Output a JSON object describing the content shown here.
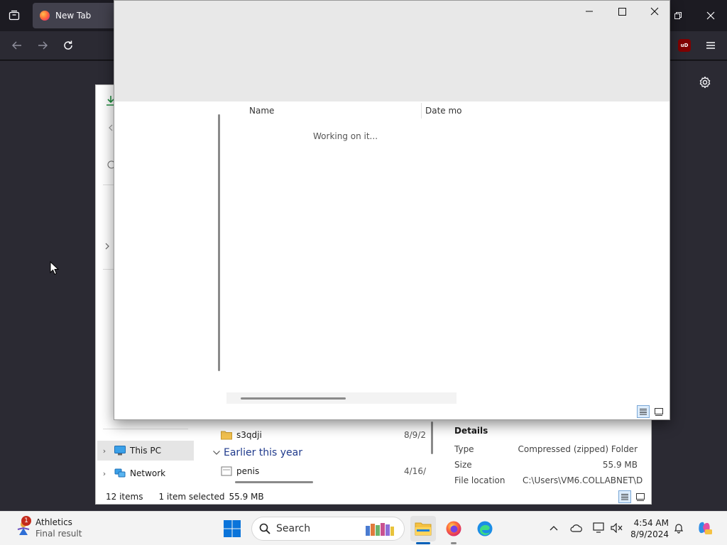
{
  "firefox": {
    "tab_title": "New Tab",
    "ublock_label": "uD"
  },
  "explorer": {
    "nav": {
      "this_pc": "This PC",
      "network": "Network"
    },
    "files": {
      "item1_name": "s3qdji",
      "item1_date": "8/9/2",
      "group_label": "Earlier this year",
      "item2_name": "penis",
      "item2_date": "4/16/"
    },
    "details": {
      "title": "Details",
      "type_key": "Type",
      "type_value": "Compressed (zipped) Folder",
      "size_key": "Size",
      "size_value": "55.9 MB",
      "location_key": "File location",
      "location_value": "C:\\Users\\VM6.COLLABNET\\D"
    },
    "status": {
      "items": "12 items",
      "selected": "1 item selected",
      "size": "55.9 MB"
    }
  },
  "dialog": {
    "columns": {
      "name": "Name",
      "date": "Date mo"
    },
    "working_text": "Working on it..."
  },
  "taskbar": {
    "widget": {
      "badge": "1",
      "title": "Athletics",
      "subtitle": "Final result"
    },
    "search_label": "Search",
    "clock": {
      "time": "4:54 AM",
      "date": "8/9/2024"
    }
  },
  "colors": {
    "accent": "#005fb8",
    "firefox_bg": "#1c1b22",
    "firefox_toolbar": "#2b2a33",
    "badge_red": "#c42b1c"
  }
}
